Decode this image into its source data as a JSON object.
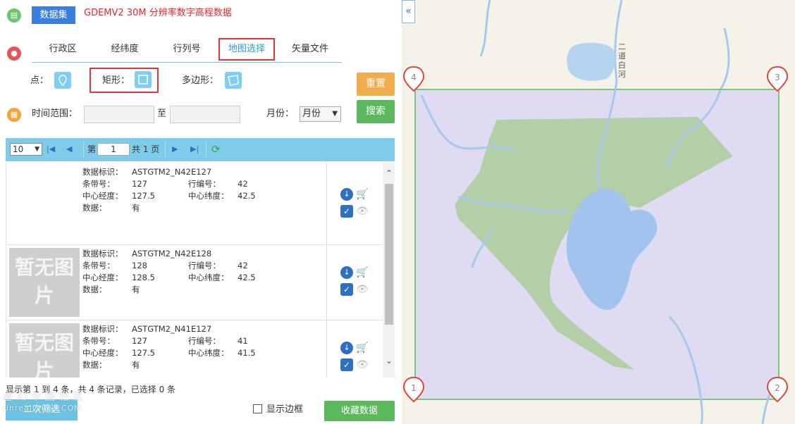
{
  "dataset": {
    "badge": "数据集",
    "name": "GDEMV2 30M 分辨率数字高程数据"
  },
  "tabs": [
    {
      "label": "行政区"
    },
    {
      "label": "经纬度"
    },
    {
      "label": "行列号"
    },
    {
      "label": "地图选择",
      "active": true
    },
    {
      "label": "矢量文件"
    }
  ],
  "selection": {
    "point_label": "点：",
    "rect_label": "矩形：",
    "polygon_label": "多边形：",
    "active_tool": "rectangle"
  },
  "buttons": {
    "reset": "重置",
    "search": "搜索",
    "filter": "二次筛选",
    "save": "收藏数据"
  },
  "time": {
    "label": "时间范围：",
    "to": "至",
    "start_value": "",
    "end_value": "",
    "month_label": "月份：",
    "month_value": "月份"
  },
  "pager": {
    "page_size": "10",
    "di": "第",
    "current": "1",
    "total": "共 1 页"
  },
  "results": [
    {
      "id_label": "数据标识：",
      "id": "ASTGTM2_N42E127",
      "path_label": "条带号：",
      "path": "127",
      "row_label": "行编号：",
      "row": "42",
      "clon_label": "中心经度：",
      "clon": "127.5",
      "clat_label": "中心纬度：",
      "clat": "42.5",
      "data_label": "数据：",
      "data": "有",
      "thumb": ""
    },
    {
      "id_label": "数据标识：",
      "id": "ASTGTM2_N42E128",
      "path_label": "条带号：",
      "path": "128",
      "row_label": "行编号：",
      "row": "42",
      "clon_label": "中心经度：",
      "clon": "128.5",
      "clat_label": "中心纬度：",
      "clat": "42.5",
      "data_label": "数据：",
      "data": "有",
      "thumb": "暂无图片"
    },
    {
      "id_label": "数据标识：",
      "id": "ASTGTM2_N41E127",
      "path_label": "条带号：",
      "path": "127",
      "row_label": "行编号：",
      "row": "41",
      "clon_label": "中心经度：",
      "clon": "127.5",
      "clat_label": "中心纬度：",
      "clat": "41.5",
      "data_label": "数据：",
      "data": "有",
      "thumb": "暂无图片"
    }
  ],
  "summary": "显示第 1 到 4 条，共 4 条记录，已选择 0 条",
  "show_border": "显示边框",
  "watermark": {
    "main": "虚幻中国社区",
    "sub": "UnrealChina.COM"
  },
  "map": {
    "river_label": "二道白河",
    "markers": [
      "1",
      "2",
      "3",
      "4"
    ],
    "colors": {
      "selection_fill": "#dcd9f2",
      "selection_stroke": "#58bd58",
      "forest": "#b2cfa8",
      "water": "#a3c3ef",
      "marker": "#e0443a"
    }
  },
  "icons": {
    "dataset": "file-icon",
    "region": "map-pin-icon",
    "time": "calendar-icon",
    "download": "download-icon",
    "cart": "cart-icon",
    "check": "check-icon",
    "preview": "eye-icon"
  }
}
